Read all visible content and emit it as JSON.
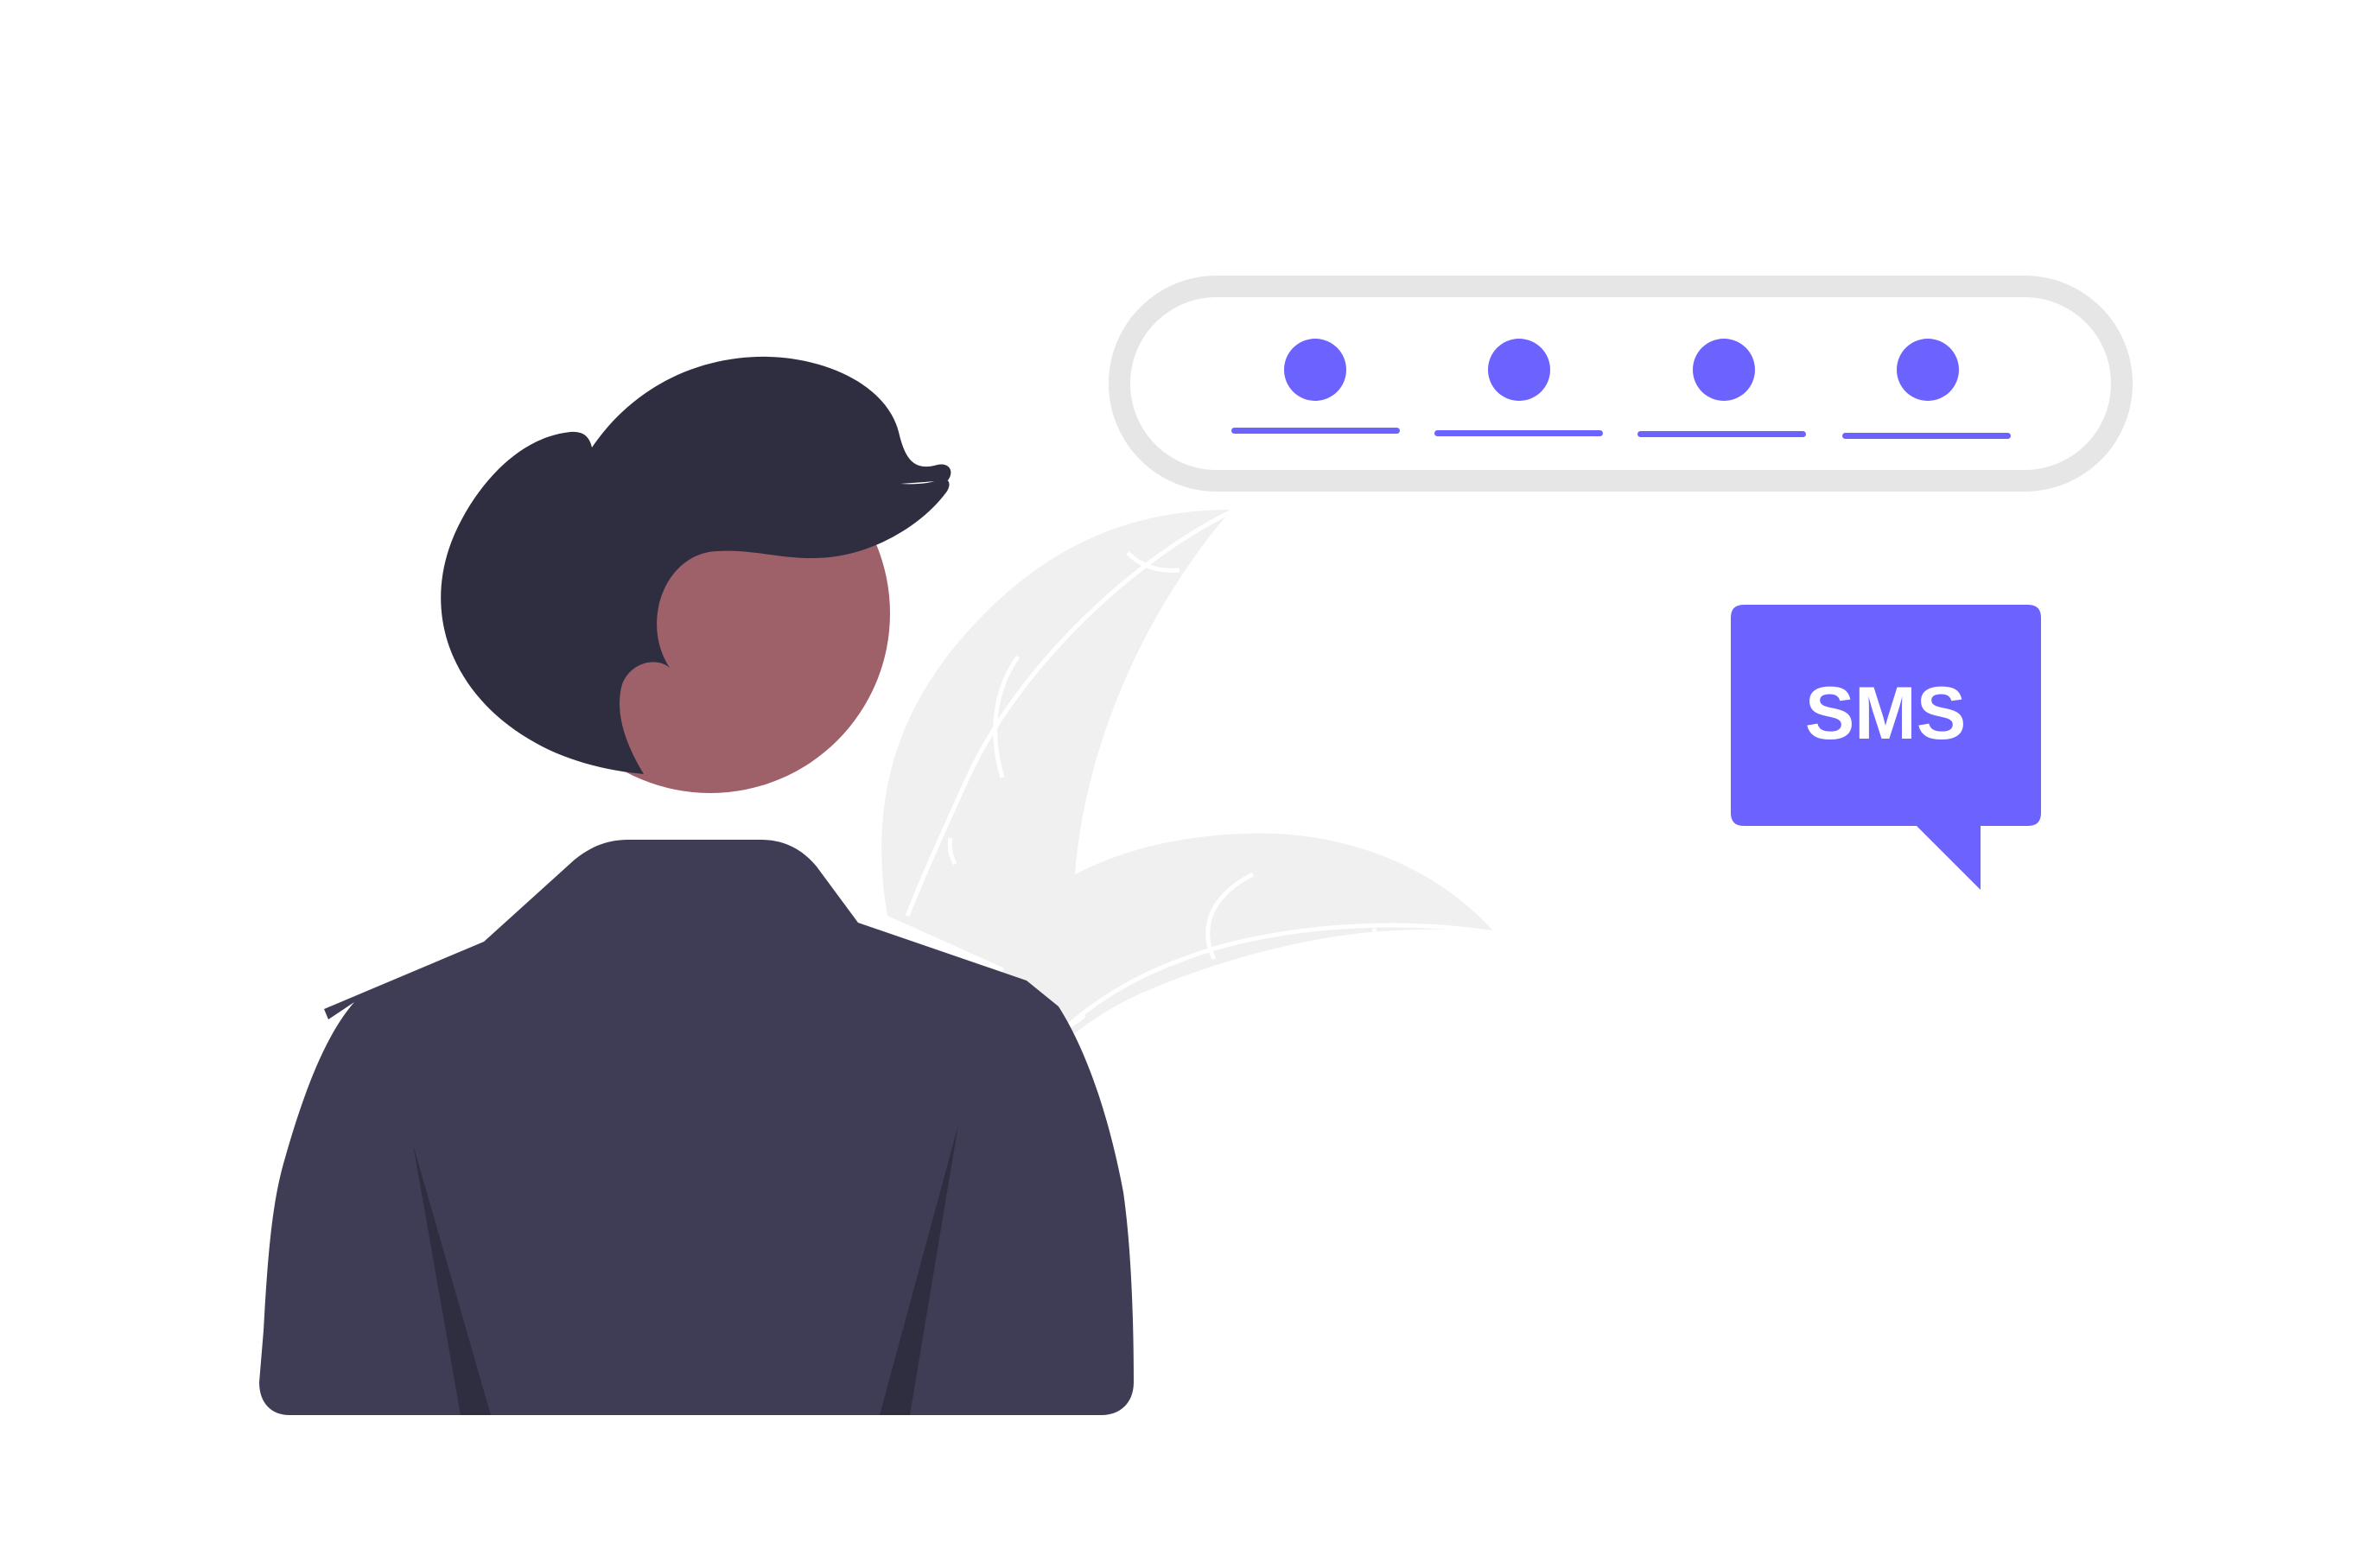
{
  "illustration": {
    "subject": "person-with-sms-verification-code",
    "code_input": {
      "digit_count": 4,
      "state": "masked"
    },
    "sms_bubble": {
      "label": "SMS"
    }
  },
  "colors": {
    "accent": "#6c63ff",
    "hair": "#2f2e41",
    "jacket": "#3f3d56",
    "jacket_shadow": "#2f2e41",
    "skin": "#9e616a",
    "plant": "#f0f0f0",
    "plant_vein": "#ffffff",
    "field_border": "#e6e6e6",
    "background": "#ffffff"
  }
}
